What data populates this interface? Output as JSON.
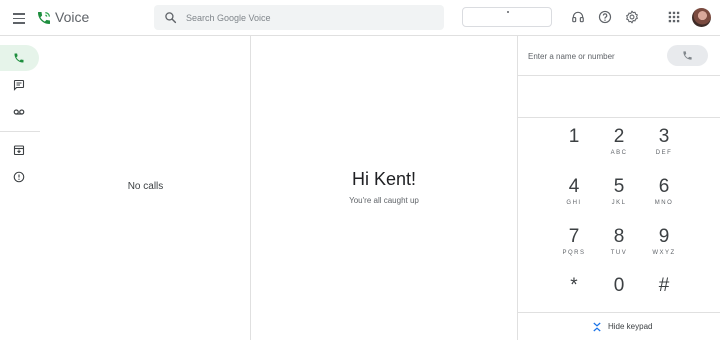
{
  "header": {
    "app_title": "Voice",
    "search_placeholder": "Search Google Voice",
    "icons": [
      "menu-icon",
      "voice-logo-icon",
      "search-icon",
      "headset-icon",
      "help-icon",
      "settings-icon",
      "apps-grid-icon",
      "avatar"
    ]
  },
  "nav": {
    "items": [
      {
        "name": "calls",
        "icon": "phone-icon",
        "active": true
      },
      {
        "name": "messages",
        "icon": "message-icon",
        "active": false
      },
      {
        "name": "voicemail",
        "icon": "voicemail-icon",
        "active": false
      },
      {
        "name": "archive",
        "icon": "archive-icon",
        "active": false
      },
      {
        "name": "spam",
        "icon": "spam-icon",
        "active": false
      }
    ]
  },
  "calls": {
    "empty_text": "No calls"
  },
  "main": {
    "greeting": "Hi Kent!",
    "subtext": "You're all caught up"
  },
  "dialer": {
    "input_placeholder": "Enter a name or number",
    "keys": [
      {
        "digit": "1",
        "letters": ""
      },
      {
        "digit": "2",
        "letters": "ABC"
      },
      {
        "digit": "3",
        "letters": "DEF"
      },
      {
        "digit": "4",
        "letters": "GHI"
      },
      {
        "digit": "5",
        "letters": "JKL"
      },
      {
        "digit": "6",
        "letters": "MNO"
      },
      {
        "digit": "7",
        "letters": "PQRS"
      },
      {
        "digit": "8",
        "letters": "TUV"
      },
      {
        "digit": "9",
        "letters": "WXYZ"
      },
      {
        "digit": "*",
        "letters": ""
      },
      {
        "digit": "0",
        "letters": ""
      },
      {
        "digit": "#",
        "letters": ""
      }
    ],
    "hide_keypad_label": "Hide keypad"
  },
  "colors": {
    "accent_green": "#1e8e3e",
    "active_nav_bg": "#e6f4ea",
    "search_bg": "#f1f3f4"
  }
}
